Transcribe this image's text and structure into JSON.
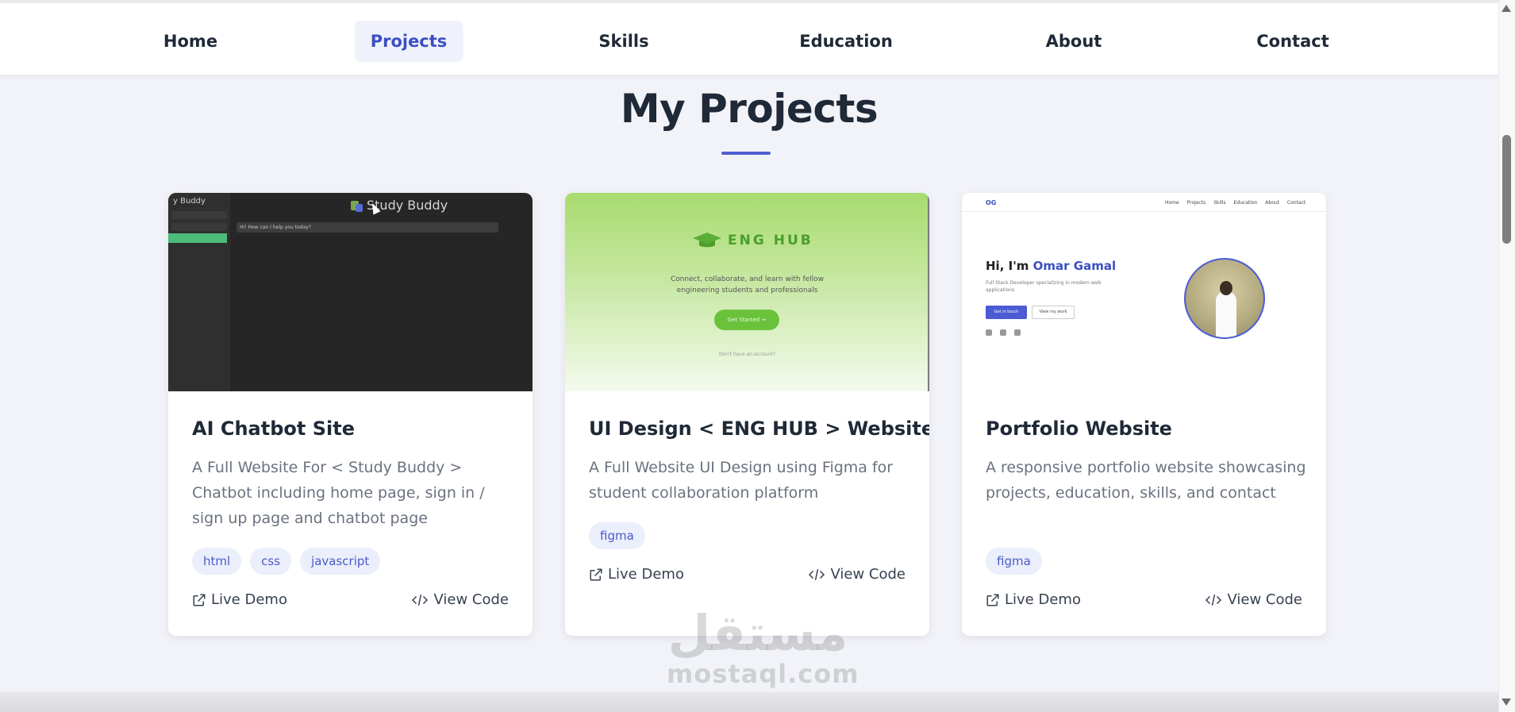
{
  "nav": {
    "items": [
      {
        "label": "Home",
        "active": false
      },
      {
        "label": "Projects",
        "active": true
      },
      {
        "label": "Skills",
        "active": false
      },
      {
        "label": "Education",
        "active": false
      },
      {
        "label": "About",
        "active": false
      },
      {
        "label": "Contact",
        "active": false
      }
    ]
  },
  "section": {
    "title": "My Projects"
  },
  "projects": [
    {
      "title": "AI Chatbot Site",
      "description": "A Full Website For < Study Buddy > Chatbot including home page, sign in / sign up page and chatbot page",
      "tags": [
        "html",
        "css",
        "javascript"
      ],
      "live_demo": "Live Demo",
      "view_code": "View Code",
      "thumbnail": {
        "app_title": "Study Buddy",
        "sidebar_brand": "y Buddy",
        "input_text": "Hi! How can I help you today?"
      }
    },
    {
      "title": "UI Design < ENG HUB > Website",
      "description": "A Full Website UI Design using Figma for student collaboration platform",
      "tags": [
        "figma"
      ],
      "live_demo": "Live Demo",
      "view_code": "View Code",
      "thumbnail": {
        "brand": "ENG HUB",
        "tagline_1": "Connect, collaborate, and learn with fellow",
        "tagline_2": "engineering students and professionals",
        "button": "Get Started  →",
        "footnote": "Don't have an account?"
      }
    },
    {
      "title": "Portfolio Website",
      "description": "A responsive portfolio website showcasing projects, education, skills, and contact",
      "tags": [
        "figma"
      ],
      "live_demo": "Live Demo",
      "view_code": "View Code",
      "thumbnail": {
        "logo": "OG",
        "nav": "Home Projects Skills Education About Contact",
        "greeting": "Hi, I'm ",
        "name": "Omar Gamal",
        "subtitle": "Full Stack Developer specializing in modern web applications",
        "primary_button": "Get in touch",
        "secondary_button": "View my work"
      }
    }
  ],
  "watermark": {
    "arabic": "مستقل",
    "latin": "mostaql.com"
  },
  "colors": {
    "accent": "#3b4fc4",
    "tag_bg": "#ebeefb",
    "page_bg": "#f2f3f8"
  }
}
